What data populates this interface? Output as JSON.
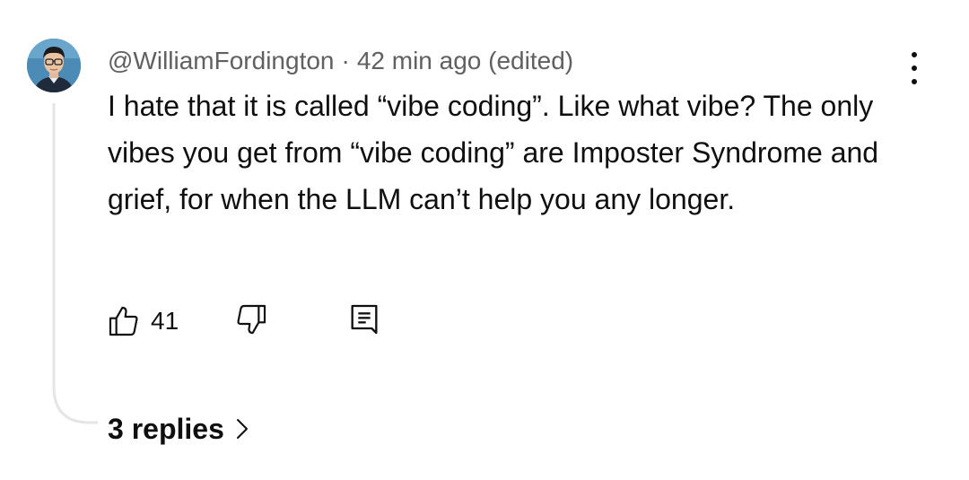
{
  "comment": {
    "author": "@WilliamFordington",
    "separator": "·",
    "timestamp": "42 min ago",
    "edited_label": "(edited)",
    "text": "I hate that it is called “vibe coding”. Like what vibe? The only vibes you get from “vibe coding” are Imposter Syndrome and grief, for when the LLM can’t help you any longer.",
    "like_count": "41",
    "replies_label": "3 replies"
  },
  "icons": {
    "avatar": "avatar-portrait",
    "more": "kebab-menu-icon",
    "like": "thumbs-up-outline-icon",
    "dislike": "thumbs-down-outline-icon",
    "reply": "reply-comment-icon",
    "chevron": "chevron-right-icon"
  },
  "colors": {
    "text_primary": "#0f0f0f",
    "text_secondary": "#606060",
    "thread_line": "#e5e5e5",
    "avatar_bg": "#4b8bb5"
  }
}
